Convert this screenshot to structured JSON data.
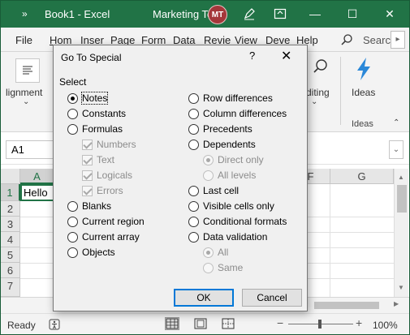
{
  "titlebar": {
    "qa_chevron": "»",
    "book_title": "Book1  -  Excel",
    "team": "Marketing Team",
    "avatar_initials": "MT",
    "minimize": "—",
    "maximize": "☐",
    "close": "✕"
  },
  "tabs": {
    "items": [
      "File",
      "Hom",
      "Inser",
      "Page",
      "Form",
      "Data",
      "Revie",
      "View",
      "Deve",
      "Help"
    ],
    "active": "Hom",
    "search": "Searc",
    "scroll": "▸"
  },
  "ribbon": {
    "alignment": "lignment",
    "alignment_chevron": "⌄",
    "editing": "diting",
    "editing_chevron": "⌄",
    "ideas": "Ideas",
    "group_label": "Ideas",
    "collapse": "⌃"
  },
  "formula_bar": {
    "name_box": "A1",
    "expand": "⌄"
  },
  "grid": {
    "col_headers": [
      "A",
      "F",
      "G"
    ],
    "row_headers": [
      "1",
      "2",
      "3",
      "4",
      "5",
      "6",
      "7"
    ],
    "cell_a1": "Hello"
  },
  "status": {
    "ready": "Ready",
    "zoom_minus": "−",
    "zoom_plus": "+",
    "zoom": "100%"
  },
  "dialog": {
    "title": "Go To Special",
    "help": "?",
    "close": "✕",
    "select_label": "Select",
    "left_options": [
      {
        "label": "Notes",
        "checked": true
      },
      {
        "label": "Constants"
      },
      {
        "label": "Formulas"
      },
      {
        "label": "Numbers",
        "type": "check",
        "disabled": true
      },
      {
        "label": "Text",
        "type": "check",
        "disabled": true
      },
      {
        "label": "Logicals",
        "type": "check",
        "disabled": true
      },
      {
        "label": "Errors",
        "type": "check",
        "disabled": true
      },
      {
        "label": "Blanks"
      },
      {
        "label": "Current region"
      },
      {
        "label": "Current array"
      },
      {
        "label": "Objects"
      }
    ],
    "right_options": [
      {
        "label": "Row differences"
      },
      {
        "label": "Column differences"
      },
      {
        "label": "Precedents"
      },
      {
        "label": "Dependents"
      },
      {
        "label": "Direct only",
        "disabled": true,
        "checked": true
      },
      {
        "label": "All levels",
        "disabled": true
      },
      {
        "label": "Last cell"
      },
      {
        "label": "Visible cells only"
      },
      {
        "label": "Conditional formats"
      },
      {
        "label": "Data validation"
      },
      {
        "label": "All",
        "disabled": true,
        "checked": true
      },
      {
        "label": "Same",
        "disabled": true
      }
    ],
    "ok": "OK",
    "cancel": "Cancel"
  }
}
